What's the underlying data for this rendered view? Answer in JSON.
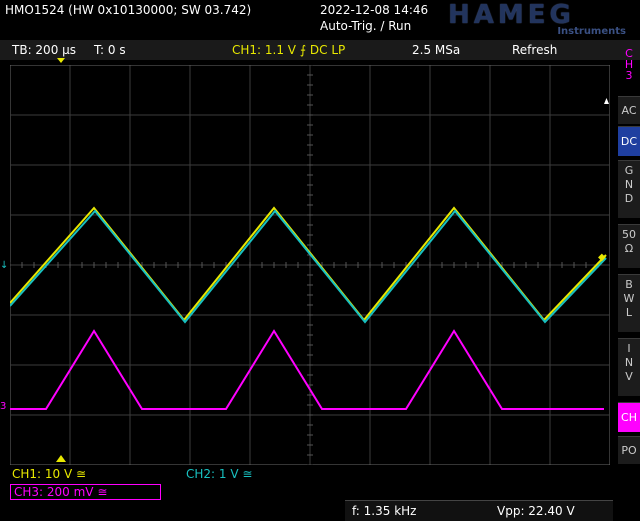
{
  "header": {
    "device_info": "HMO1524 (HW 0x10130000; SW 03.742)",
    "timestamp": "2022-12-08 14:46",
    "trigger_status": "Auto-Trig. / Run",
    "brand": "HAMEG",
    "brand_sub": "Instruments"
  },
  "info_bar": {
    "timebase": "TB: 200 µs",
    "trigger_time": "T: 0 s",
    "ch1_trigger": "CH1: 1.1 V ⨍ DC LP",
    "sample_rate": "2.5 MSa",
    "mode": "Refresh"
  },
  "sidebar": {
    "channel": [
      "C",
      "H",
      "3"
    ],
    "buttons": [
      {
        "label": "AC",
        "selected": false
      },
      {
        "label": "DC",
        "selected": true
      },
      {
        "label": "G\nN\nD",
        "selected": false
      },
      {
        "label": "50\nΩ",
        "selected": false
      },
      {
        "label": "B\nW\nL",
        "selected": false
      },
      {
        "label": "I\nN\nV",
        "selected": false
      },
      {
        "label": "CH",
        "selected": true
      },
      {
        "label": "PO",
        "selected": false
      }
    ]
  },
  "channels": {
    "ch1_label": "CH1: 10 V ≅",
    "ch2_label": "CH2: 1 V ≅",
    "ch3_label": "CH3: 200 mV ≅"
  },
  "measurements": {
    "frequency": "f: 1.35 kHz",
    "vpp": "Vpp: 22.40 V"
  },
  "colors": {
    "ch1": "#e8e800",
    "ch2": "#18c0c0",
    "ch3": "#ff00ff",
    "selected_button": "#1f3fa0"
  },
  "trace_data": {
    "ch1_ch2_peaks_x_div": [
      1.4,
      4.4,
      7.4
    ],
    "ch1_ch2_troughs_x_div": [
      2.9,
      5.9,
      8.9
    ],
    "ch3_pulse_peaks_x_div": [
      1.4,
      4.4,
      7.4
    ]
  }
}
